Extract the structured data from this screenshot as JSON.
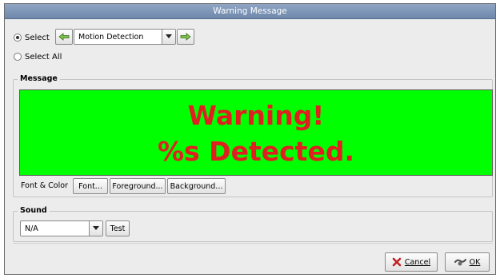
{
  "window": {
    "title": "Warning Message"
  },
  "selection": {
    "select_label": "Select",
    "select_all_label": "Select All",
    "selected_option": "select",
    "event_value": "Motion Detection"
  },
  "message": {
    "section_title": "Message",
    "preview_line1": "Warning!",
    "preview_line2": "%s Detected.",
    "preview_bg_color": "#00ff00",
    "preview_fg_color": "#e02020",
    "font_color_label": "Font & Color",
    "font_button": "Font...",
    "foreground_button": "Foreground...",
    "background_button": "Background..."
  },
  "sound": {
    "section_title": "Sound",
    "value": "N/A",
    "test_button": "Test"
  },
  "footer": {
    "cancel_button": "Cancel",
    "ok_button": "OK"
  },
  "icons": {
    "prev": "arrow-left-icon",
    "next": "arrow-right-icon",
    "dropdown": "chevron-down-icon",
    "cancel": "cancel-x-icon",
    "ok": "ok-check-icon"
  }
}
